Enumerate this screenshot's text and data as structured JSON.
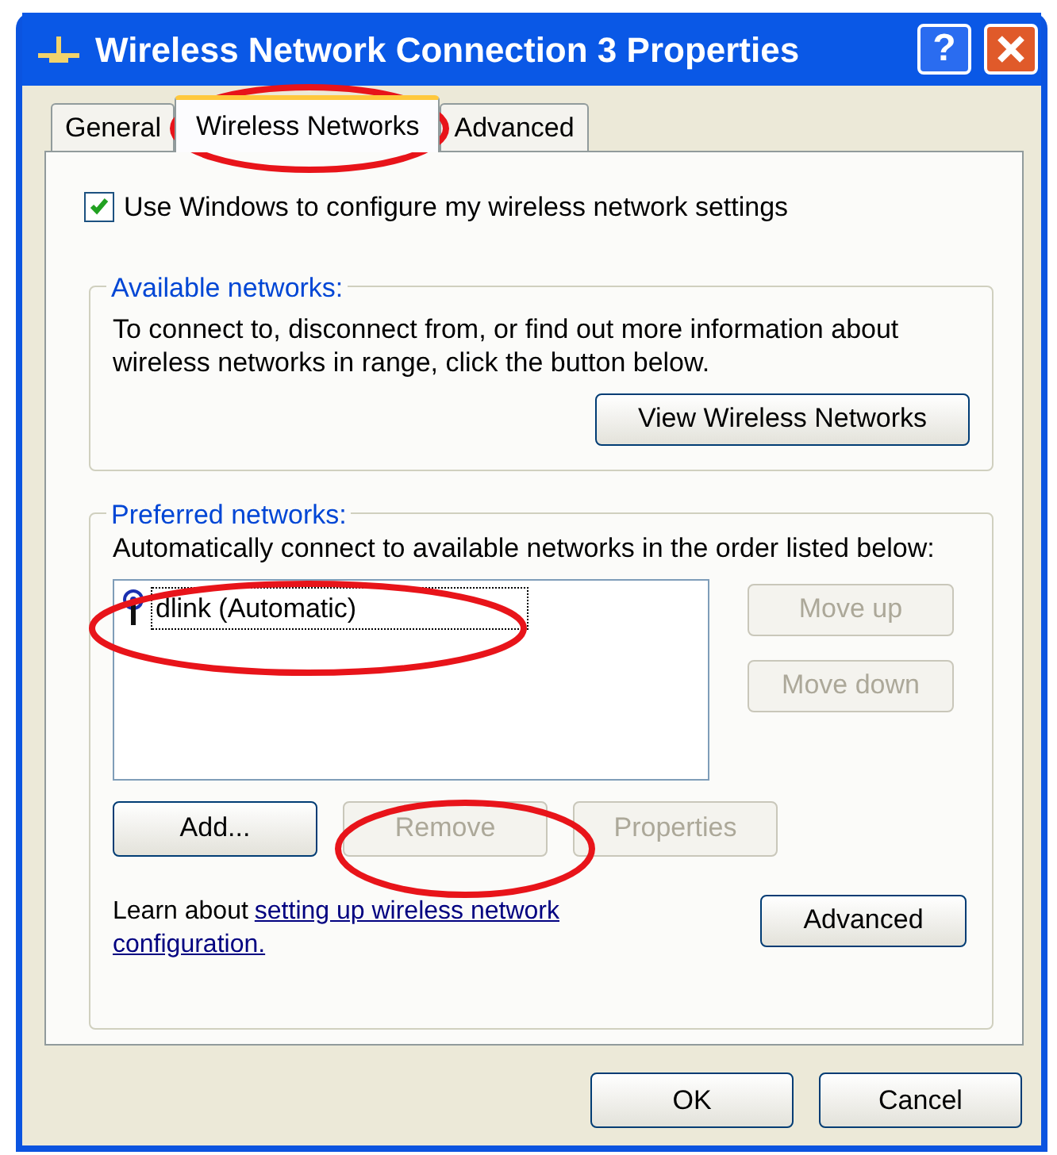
{
  "window": {
    "title": "Wireless Network Connection 3 Properties",
    "help_label": "?"
  },
  "tabs": [
    {
      "label": "General",
      "selected": false
    },
    {
      "label": "Wireless Networks",
      "selected": true
    },
    {
      "label": "Advanced",
      "selected": false
    }
  ],
  "use_windows_checkbox": {
    "label": "Use Windows to configure my wireless network settings",
    "checked": true
  },
  "available_networks": {
    "title": "Available networks:",
    "description": "To connect to, disconnect from, or find out more information about wireless networks in range, click the button below.",
    "button": {
      "label": "View Wireless Networks",
      "disabled": false
    }
  },
  "preferred_networks": {
    "title": "Preferred networks:",
    "description": "Automatically connect to available networks in the order listed below:",
    "networks": [
      {
        "name": "dlink (Automatic)",
        "focused": true
      }
    ],
    "side_buttons": [
      {
        "label": "Move up",
        "disabled": true
      },
      {
        "label": "Move down",
        "disabled": true
      }
    ],
    "buttons": [
      {
        "label": "Add...",
        "disabled": false
      },
      {
        "label": "Remove",
        "disabled": true
      },
      {
        "label": "Properties",
        "disabled": true
      }
    ]
  },
  "learn": {
    "prefix": "Learn about",
    "link_lines": [
      "setting up wireless network",
      "configuration."
    ]
  },
  "advanced_button": {
    "label": "Advanced",
    "disabled": false
  },
  "dialog_buttons": [
    {
      "label": "OK",
      "disabled": false
    },
    {
      "label": "Cancel",
      "disabled": false
    }
  ]
}
